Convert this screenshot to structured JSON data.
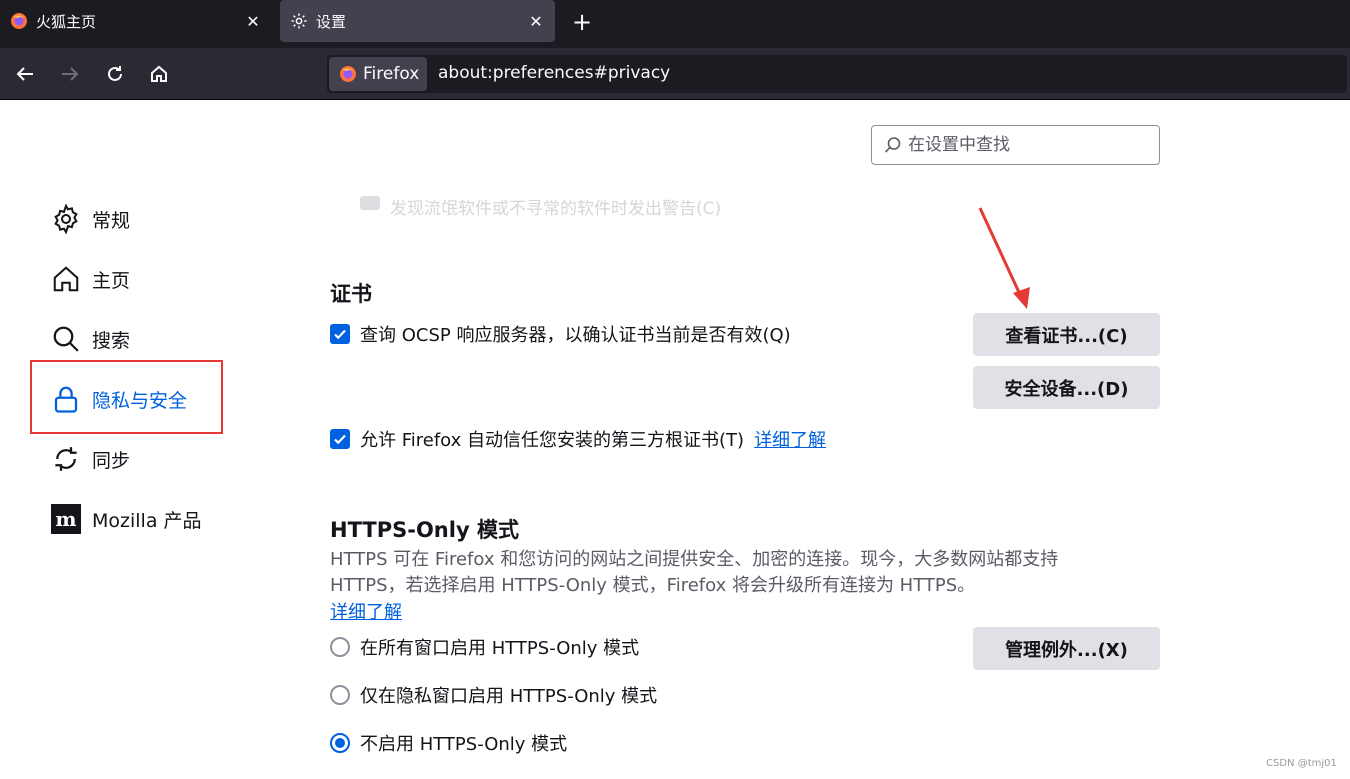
{
  "browser": {
    "tabs": [
      {
        "label": "火狐主页",
        "icon": "firefox-icon"
      },
      {
        "label": "设置",
        "icon": "gear-icon",
        "active": true
      }
    ],
    "new_tab_symbol": "+",
    "identity_label": "Firefox",
    "url": "about:preferences#privacy"
  },
  "search": {
    "placeholder": "在设置中查找"
  },
  "sidebar": {
    "items": [
      {
        "label": "常规",
        "icon": "gear-icon"
      },
      {
        "label": "主页",
        "icon": "home-icon"
      },
      {
        "label": "搜索",
        "icon": "search-icon"
      },
      {
        "label": "隐私与安全",
        "icon": "lock-icon",
        "selected": true
      },
      {
        "label": "同步",
        "icon": "sync-icon"
      },
      {
        "label": "Mozilla 产品",
        "icon": "mozilla-icon"
      }
    ]
  },
  "faded_text": "发现流氓软件或不寻常的软件时发出警告(C)",
  "certificates": {
    "heading": "证书",
    "ocsp_label": "查询 OCSP 响应服务器，以确认证书当前是否有效(Q)",
    "view_button": "查看证书...(C)",
    "devices_button": "安全设备...(D)",
    "third_party_label": "允许 Firefox 自动信任您安装的第三方根证书(T)",
    "learn_more": "详细了解"
  },
  "https_only": {
    "heading": "HTTPS-Only 模式",
    "description": "HTTPS 可在 Firefox 和您访问的网站之间提供安全、加密的连接。现今，大多数网站都支持 HTTPS，若选择启用 HTTPS-Only 模式，Firefox 将会升级所有连接为 HTTPS。",
    "learn_more": "详细了解",
    "exceptions_button": "管理例外...(X)",
    "options": [
      {
        "label": "在所有窗口启用 HTTPS-Only 模式",
        "selected": false
      },
      {
        "label": "仅在隐私窗口启用 HTTPS-Only 模式",
        "selected": false
      },
      {
        "label": "不启用 HTTPS-Only 模式",
        "selected": true
      }
    ]
  },
  "watermark": "CSDN @tmj01",
  "colors": {
    "accent": "#0061e0",
    "highlight": "#e53935",
    "chrome_dark": "#1c1b22"
  }
}
